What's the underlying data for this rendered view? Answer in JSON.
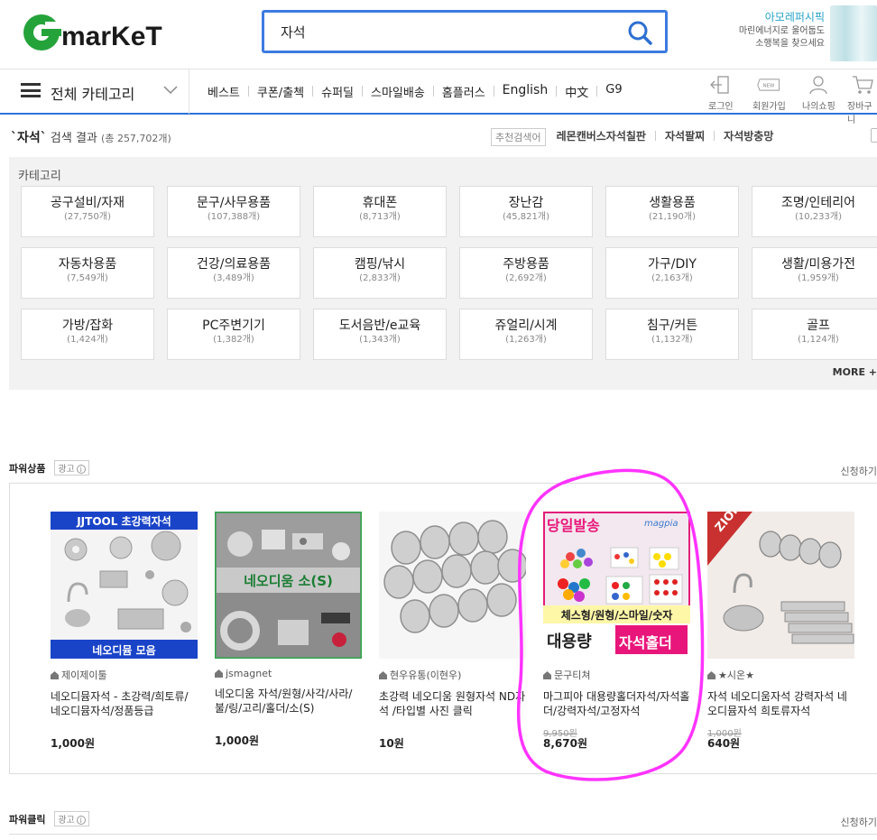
{
  "header": {
    "logo_text": "Gmarket",
    "search_value": "자석",
    "ad_title": "아모레퍼시픽",
    "ad_text_line1": "마린에너지로 울어둡도",
    "ad_text_line2": "소행복을 찾으세요"
  },
  "nav": {
    "category_label": "전체 카테고리",
    "links": [
      "베스트",
      "쿠폰/출첵",
      "슈퍼딜",
      "스마일배송",
      "홈플러스",
      "English",
      "中文",
      "G9"
    ],
    "util": [
      {
        "label": "로그인",
        "icon": "login-icon"
      },
      {
        "label": "회원가입",
        "icon": "new-badge-icon"
      },
      {
        "label": "나의쇼핑",
        "icon": "person-icon"
      },
      {
        "label": "장바구니",
        "icon": "cart-icon"
      }
    ]
  },
  "result": {
    "keyword": "`자석`",
    "text": "검색 결과",
    "count": "(총 257,702개)",
    "related_label": "추천검색어",
    "related": [
      "레몬캔버스자석칠판",
      "자석팔찌",
      "자석방충망"
    ]
  },
  "categories": {
    "title": "카테고리",
    "more": "MORE +",
    "items": [
      {
        "name": "공구설비/자재",
        "count": "(27,750개)"
      },
      {
        "name": "문구/사무용품",
        "count": "(107,388개)"
      },
      {
        "name": "휴대폰",
        "count": "(8,713개)"
      },
      {
        "name": "장난감",
        "count": "(45,821개)"
      },
      {
        "name": "생활용품",
        "count": "(21,190개)"
      },
      {
        "name": "조명/인테리어",
        "count": "(10,233개)"
      },
      {
        "name": "자동차용품",
        "count": "(7,549개)"
      },
      {
        "name": "건강/의료용품",
        "count": "(3,489개)"
      },
      {
        "name": "캠핑/낚시",
        "count": "(2,833개)"
      },
      {
        "name": "주방용품",
        "count": "(2,692개)"
      },
      {
        "name": "가구/DIY",
        "count": "(2,163개)"
      },
      {
        "name": "생활/미용가전",
        "count": "(1,959개)"
      },
      {
        "name": "가방/잡화",
        "count": "(1,424개)"
      },
      {
        "name": "PC주변기기",
        "count": "(1,382개)"
      },
      {
        "name": "도서음반/e교육",
        "count": "(1,343개)"
      },
      {
        "name": "쥬얼리/시계",
        "count": "(1,263개)"
      },
      {
        "name": "침구/커튼",
        "count": "(1,132개)"
      },
      {
        "name": "골프",
        "count": "(1,124개)"
      }
    ]
  },
  "power_products": {
    "title": "파워상품",
    "ad_label": "광고",
    "apply": "신청하기",
    "items": [
      {
        "seller": "제이제이툴",
        "title": "네오디뮴자석 - 초강력/희토류/네오디뮴자석/정품등급",
        "old_price": "",
        "price": "1,000원",
        "img_top": "JJTOOL 초강력자석",
        "img_bottom": "네오디뮴 모음"
      },
      {
        "seller": "jsmagnet",
        "title": "네오디움 자석/원형/사각/사라/불/링/고리/홀더/소(S)",
        "old_price": "",
        "price": "1,000원",
        "img_label": "네오디움 소(S)"
      },
      {
        "seller": "현우유통(이현우)",
        "title": "초강력 네오디움 원형자석 ND자석 /타입별 사진 클릭",
        "old_price": "",
        "price": "10원"
      },
      {
        "seller": "문구티쳐",
        "title": "마그피아 대용량홀더자석/자석홀더/강력자석/고정자석",
        "old_price": "9,950원",
        "price": "8,670원",
        "img_top": "당일발송",
        "img_mid": "체스형/원형/스마일/숫자",
        "img_bottom1": "대용량",
        "img_bottom2": "자석홀더",
        "img_brand": "magpia"
      },
      {
        "seller": "★시온★",
        "title": "자석 네오디움자석 강력자석 네오디뮴자석 희토류자석",
        "old_price": "1,000원",
        "price": "640원",
        "img_label": "ZION"
      }
    ]
  },
  "power_click": {
    "title": "파워클릭",
    "ad_label": "광고",
    "apply": "신청하기"
  },
  "colors": {
    "brand_green": "#25a33b",
    "search_border": "#3d7be0",
    "annotation": "#ff33ff"
  }
}
